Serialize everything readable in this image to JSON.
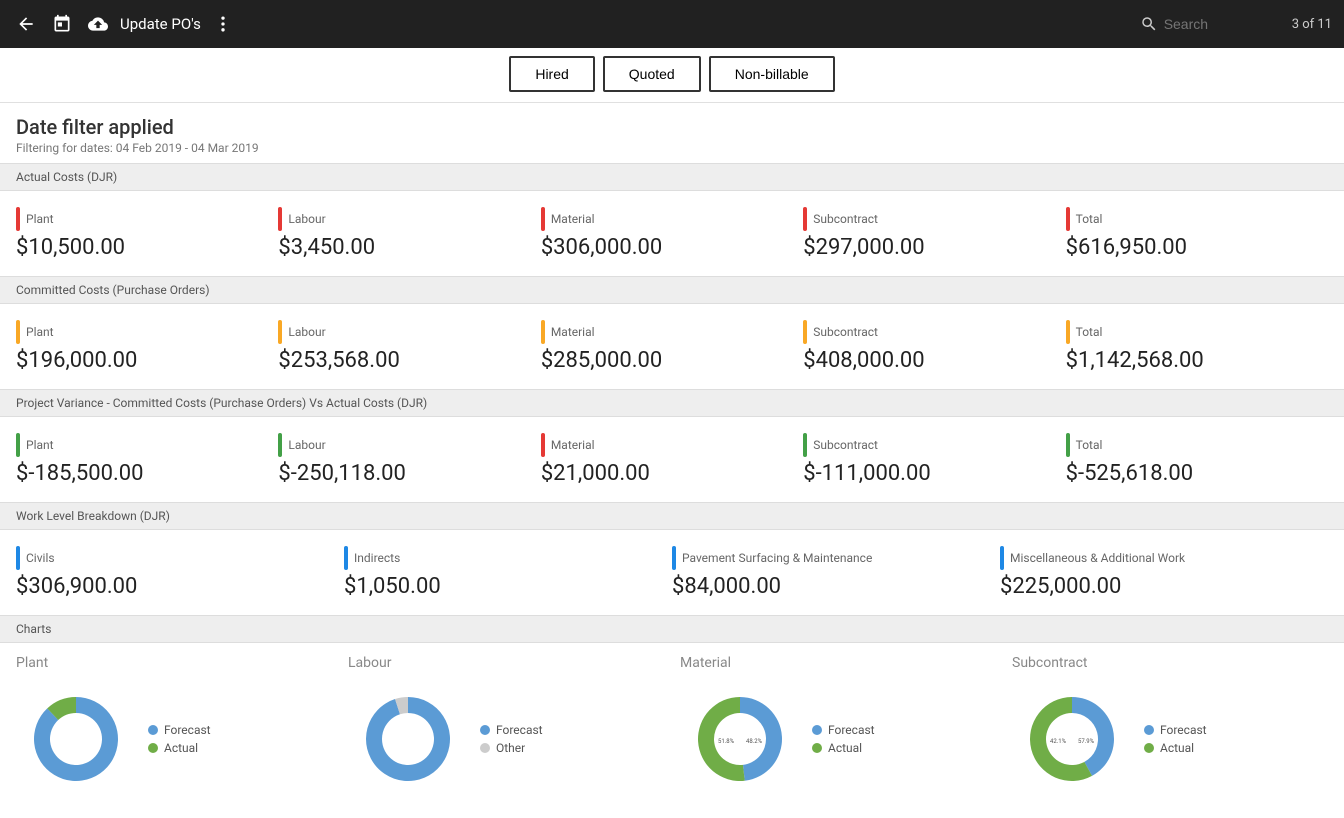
{
  "topbar": {
    "title": "Update PO's",
    "search_placeholder": "Search",
    "page_indicator": "3 of 11"
  },
  "tabs": [
    {
      "id": "hired",
      "label": "Hired",
      "active": true
    },
    {
      "id": "quoted",
      "label": "Quoted",
      "active": false
    },
    {
      "id": "non-billable",
      "label": "Non-billable",
      "active": false
    }
  ],
  "date_filter": {
    "title": "Date filter applied",
    "subtitle": "Filtering for dates: 04 Feb 2019 - 04 Mar 2019"
  },
  "actual_costs": {
    "section_title": "Actual Costs (DJR)",
    "items": [
      {
        "label": "Plant",
        "value": "$10,500.00",
        "color": "#e53935"
      },
      {
        "label": "Labour",
        "value": "$3,450.00",
        "color": "#e53935"
      },
      {
        "label": "Material",
        "value": "$306,000.00",
        "color": "#e53935"
      },
      {
        "label": "Subcontract",
        "value": "$297,000.00",
        "color": "#e53935"
      },
      {
        "label": "Total",
        "value": "$616,950.00",
        "color": "#e53935"
      }
    ]
  },
  "committed_costs": {
    "section_title": "Committed Costs (Purchase Orders)",
    "items": [
      {
        "label": "Plant",
        "value": "$196,000.00",
        "color": "#f9a825"
      },
      {
        "label": "Labour",
        "value": "$253,568.00",
        "color": "#f9a825"
      },
      {
        "label": "Material",
        "value": "$285,000.00",
        "color": "#f9a825"
      },
      {
        "label": "Subcontract",
        "value": "$408,000.00",
        "color": "#f9a825"
      },
      {
        "label": "Total",
        "value": "$1,142,568.00",
        "color": "#f9a825"
      }
    ]
  },
  "project_variance": {
    "section_title": "Project Variance - Committed Costs (Purchase Orders) Vs Actual Costs (DJR)",
    "items": [
      {
        "label": "Plant",
        "value": "$-185,500.00",
        "color": "#43a047"
      },
      {
        "label": "Labour",
        "value": "$-250,118.00",
        "color": "#43a047"
      },
      {
        "label": "Material",
        "value": "$21,000.00",
        "color": "#e53935"
      },
      {
        "label": "Subcontract",
        "value": "$-111,000.00",
        "color": "#43a047"
      },
      {
        "label": "Total",
        "value": "$-525,618.00",
        "color": "#43a047"
      }
    ]
  },
  "work_level": {
    "section_title": "Work Level Breakdown (DJR)",
    "items": [
      {
        "label": "Civils",
        "value": "$306,900.00",
        "color": "#1e88e5"
      },
      {
        "label": "Indirects",
        "value": "$1,050.00",
        "color": "#1e88e5"
      },
      {
        "label": "Pavement Surfacing & Maintenance",
        "value": "$84,000.00",
        "color": "#1e88e5"
      },
      {
        "label": "Miscellaneous & Additional Work",
        "value": "$225,000.00",
        "color": "#1e88e5"
      }
    ]
  },
  "charts": {
    "section_title": "Charts",
    "items": [
      {
        "title": "Plant",
        "forecast_pct": 88,
        "actual_pct": 12,
        "legend": [
          {
            "label": "Forecast",
            "color": "#5b9bd5"
          },
          {
            "label": "Actual",
            "color": "#70ad47"
          }
        ],
        "center_text": ""
      },
      {
        "title": "Labour",
        "forecast_pct": 95,
        "actual_pct": 5,
        "legend": [
          {
            "label": "Forecast",
            "color": "#5b9bd5"
          },
          {
            "label": "Other",
            "color": "#cccccc"
          }
        ],
        "center_text": ""
      },
      {
        "title": "Material",
        "forecast_pct": 48.2,
        "actual_pct": 51.8,
        "legend": [
          {
            "label": "Forecast",
            "color": "#5b9bd5"
          },
          {
            "label": "Actual",
            "color": "#70ad47"
          }
        ],
        "center_text_left": "51.8%",
        "center_text_right": "48.2%"
      },
      {
        "title": "Subcontract",
        "forecast_pct": 42.1,
        "actual_pct": 57.9,
        "legend": [
          {
            "label": "Forecast",
            "color": "#5b9bd5"
          },
          {
            "label": "Actual",
            "color": "#70ad47"
          }
        ],
        "center_text_left": "42.1%",
        "center_text_right": "57.9%"
      }
    ]
  }
}
